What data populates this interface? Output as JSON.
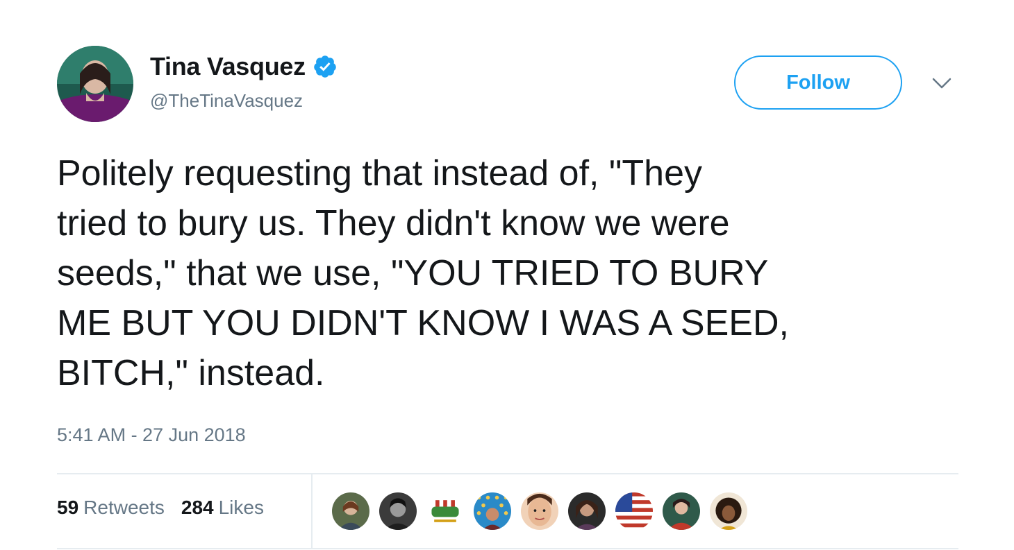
{
  "author": {
    "display_name": "Tina Vasquez",
    "handle": "@TheTinaVasquez",
    "verified": true
  },
  "follow_button": {
    "label": "Follow"
  },
  "tweet": {
    "text": "Politely requesting that instead of, \"They\ntried to bury us. They didn't know we were\nseeds,\" that we use, \"YOU TRIED TO BURY\nME BUT YOU DIDN'T KNOW I WAS A SEED,\nBITCH,\" instead.",
    "timestamp": "5:41 AM - 27 Jun 2018"
  },
  "stats": {
    "retweets_count": "59",
    "retweets_label": "Retweets",
    "likes_count": "284",
    "likes_label": "Likes"
  },
  "likers": [
    {
      "name": "liker-avatar-1"
    },
    {
      "name": "liker-avatar-2"
    },
    {
      "name": "liker-avatar-3"
    },
    {
      "name": "liker-avatar-4"
    },
    {
      "name": "liker-avatar-5"
    },
    {
      "name": "liker-avatar-6"
    },
    {
      "name": "liker-avatar-7"
    },
    {
      "name": "liker-avatar-8"
    },
    {
      "name": "liker-avatar-9"
    }
  ],
  "colors": {
    "accent": "#1da1f2",
    "text_primary": "#14171a",
    "text_secondary": "#657786",
    "divider": "#e6ecf0"
  },
  "icons": {
    "verified": "verified-badge-icon",
    "caret": "chevron-down-icon"
  }
}
